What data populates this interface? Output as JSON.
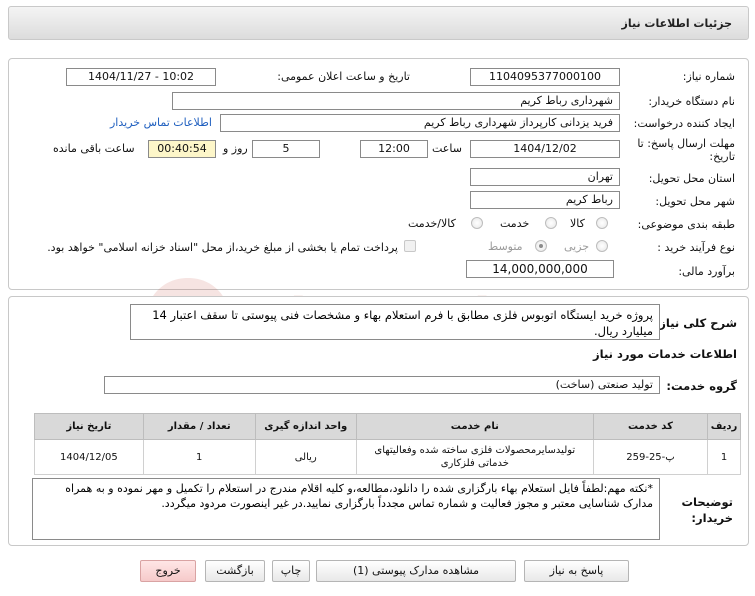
{
  "header": {
    "title": "جزئیات اطلاعات نیاز"
  },
  "need_number": {
    "label": "شماره نیاز:",
    "value": "1104095377000100"
  },
  "announce_datetime": {
    "label": "تاریخ و ساعت اعلان عمومی:",
    "value": "1404/11/27 - 10:02"
  },
  "buyer_org": {
    "label": "نام دستگاه خریدار:",
    "value": "شهرداری رباط کریم"
  },
  "requester": {
    "label": "ایجاد کننده درخواست:",
    "value": "فرید یزدانی کارپرداز شهرداری رباط کریم",
    "contact_link": "اطلاعات تماس خریدار"
  },
  "deadline": {
    "label_line1": "مهلت ارسال پاسخ: تا",
    "label_line2": "تاریخ:",
    "date": "1404/12/02",
    "time_label": "ساعت",
    "time": "12:00",
    "days": "5",
    "days_label": "روز و",
    "remaining": "00:40:54",
    "remaining_label": "ساعت باقی مانده"
  },
  "province": {
    "label": "استان محل تحویل:",
    "value": "تهران"
  },
  "city": {
    "label": "شهر محل تحویل:",
    "value": "رباط کریم"
  },
  "category": {
    "label": "طبقه بندی موضوعی:",
    "options": [
      "کالا",
      "خدمت",
      "کالا/خدمت"
    ],
    "selected": "none"
  },
  "process": {
    "label": "نوع فرآیند خرید :",
    "options": [
      "جزیی",
      "متوسط"
    ],
    "selected": "متوسط",
    "note": "پرداخت تمام یا بخشی از مبلغ خرید،از محل \"اسناد خزانه اسلامی\" خواهد بود."
  },
  "budget": {
    "label": "برآورد مالی:",
    "value": "14,000,000,000"
  },
  "summary": {
    "label": "شرح کلی نیاز:",
    "value": "پروژه خرید ایستگاه اتوبوس فلزی مطابق با فرم استعلام بهاء و مشخصات فنی پیوستی تا سقف اعتبار 14 میلیارد ریال."
  },
  "services_heading": "اطلاعات خدمات مورد نیاز",
  "service_group": {
    "label": "گروه خدمت:",
    "value": "تولید صنعتی (ساخت)"
  },
  "table": {
    "headers": [
      "ردیف",
      "کد خدمت",
      "نام خدمت",
      "واحد اندازه گیری",
      "تعداد / مقدار",
      "تاریخ نیاز"
    ],
    "rows": [
      [
        "1",
        "پ-25-259",
        "تولیدسایرمحصولات فلزی ساخته شده وفعالیتهای خدماتی فلزکاری",
        "ریالی",
        "1",
        "1404/12/05"
      ]
    ]
  },
  "buyer_notes": {
    "label_line1": "توضیحات",
    "label_line2": "خریدار:",
    "value": "*نکته مهم:لطفاً فایل استعلام بهاء بارگزاری شده را دانلود،مطالعه،و کلیه اقلام مندرج در استعلام را تکمیل و مهر نموده و به همراه مدارک شناسایی معتبر و مجوز فعالیت و شماره تماس مجدداً بارگزاری نمایید.در غیر اینصورت مردود میگردد."
  },
  "buttons": {
    "reply": "پاسخ به نیاز",
    "attachments": "مشاهده مدارک پیوستی (1)",
    "print": "چاپ",
    "back": "بازگشت",
    "exit": "خروج"
  },
  "watermark": {
    "text": "AriaTender.net",
    "color": "#c0392b"
  },
  "colors": {
    "link": "#1f5fbf",
    "remaining_bg": "#fdf6c9",
    "exit_bg": "#f6caca",
    "header_bg": "#dcdcdc"
  }
}
